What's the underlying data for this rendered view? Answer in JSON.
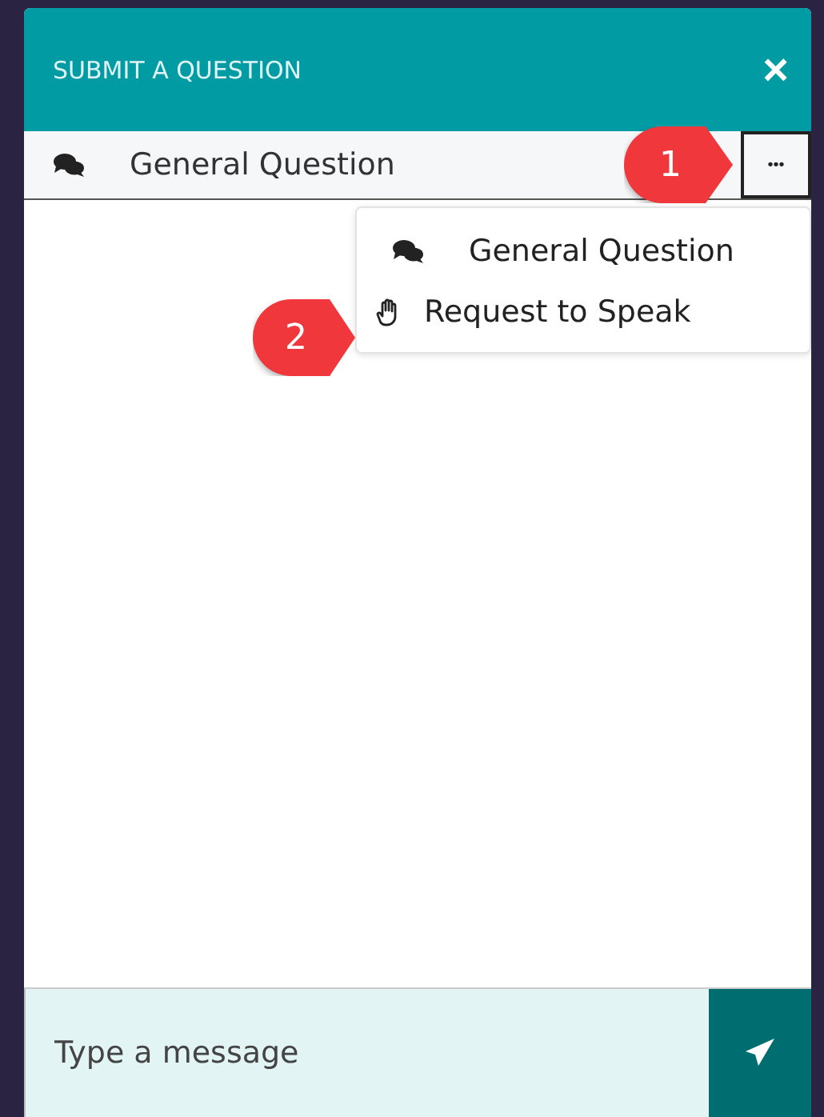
{
  "header": {
    "title": "SUBMIT A QUESTION",
    "close": "×"
  },
  "question_type": {
    "label": "General Question",
    "more": "•••"
  },
  "menu": {
    "items": [
      {
        "label": "General Question",
        "kind": "chat"
      },
      {
        "label": "Request to Speak",
        "kind": "hand"
      }
    ]
  },
  "callouts": [
    {
      "label": "1",
      "kind": "more"
    },
    {
      "label": "2",
      "kind": "menu"
    }
  ],
  "composer": {
    "placeholder": "Type a message"
  }
}
